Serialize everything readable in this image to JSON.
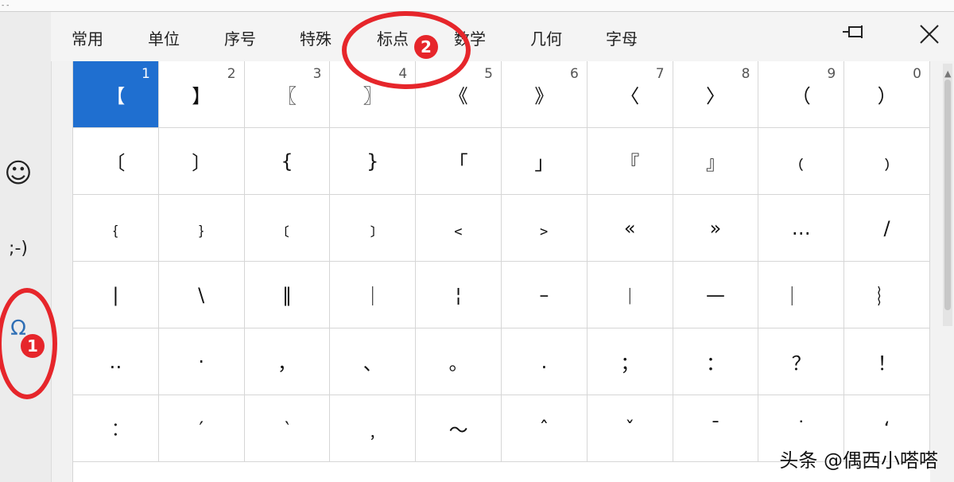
{
  "tabs": [
    "常用",
    "单位",
    "序号",
    "特殊",
    "标点",
    "数学",
    "几何",
    "字母"
  ],
  "active_tab": "标点",
  "side_icons": {
    "emoji": "☺",
    "kaomoji": ";-)",
    "symbols": "Ω"
  },
  "annotations": {
    "badge1": "1",
    "badge2": "2"
  },
  "watermark": "头条 @偶西小嗒嗒",
  "rows": [
    [
      {
        "ch": "【",
        "n": "1"
      },
      {
        "ch": "】",
        "n": "2"
      },
      {
        "ch": "〖",
        "n": "3"
      },
      {
        "ch": "〗",
        "n": "4"
      },
      {
        "ch": "《",
        "n": "5"
      },
      {
        "ch": "》",
        "n": "6"
      },
      {
        "ch": "〈",
        "n": "7"
      },
      {
        "ch": "〉",
        "n": "8"
      },
      {
        "ch": "（",
        "n": "9"
      },
      {
        "ch": "）",
        "n": "0"
      }
    ],
    [
      {
        "ch": "〔"
      },
      {
        "ch": "〕"
      },
      {
        "ch": "{"
      },
      {
        "ch": "}"
      },
      {
        "ch": "「"
      },
      {
        "ch": "」"
      },
      {
        "ch": "『"
      },
      {
        "ch": "』"
      },
      {
        "ch": "﹙"
      },
      {
        "ch": "﹚"
      }
    ],
    [
      {
        "ch": "﹛"
      },
      {
        "ch": "﹜"
      },
      {
        "ch": "﹝"
      },
      {
        "ch": "﹞"
      },
      {
        "ch": "﹤"
      },
      {
        "ch": "﹥"
      },
      {
        "ch": "«"
      },
      {
        "ch": "»"
      },
      {
        "ch": "…"
      },
      {
        "ch": "/"
      }
    ],
    [
      {
        "ch": "|"
      },
      {
        "ch": "\\"
      },
      {
        "ch": "‖"
      },
      {
        "ch": "｜"
      },
      {
        "ch": "¦"
      },
      {
        "ch": "–"
      },
      {
        "ch": "︱"
      },
      {
        "ch": "—"
      },
      {
        "ch": "︳"
      },
      {
        "ch": "︴"
      }
    ],
    [
      {
        "ch": "‥"
      },
      {
        "ch": "·"
      },
      {
        "ch": "，"
      },
      {
        "ch": "、"
      },
      {
        "ch": "。"
      },
      {
        "ch": "."
      },
      {
        "ch": "；"
      },
      {
        "ch": "："
      },
      {
        "ch": "？"
      },
      {
        "ch": "！"
      }
    ],
    [
      {
        "ch": "︰"
      },
      {
        "ch": "′"
      },
      {
        "ch": "‵"
      },
      {
        "ch": "﹐"
      },
      {
        "ch": "～"
      },
      {
        "ch": "ˆ"
      },
      {
        "ch": "ˇ"
      },
      {
        "ch": "ˉ"
      },
      {
        "ch": "˙"
      },
      {
        "ch": "‘"
      }
    ]
  ]
}
